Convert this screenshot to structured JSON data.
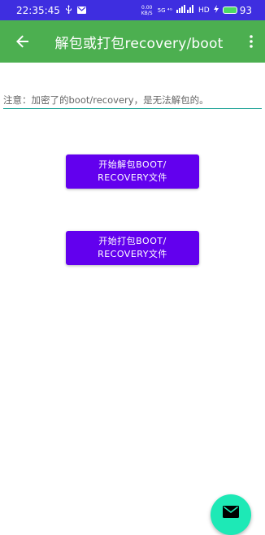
{
  "status_bar": {
    "time": "22:35:45",
    "network_speed": "0.00 KB/S",
    "signal": "5G ⁴ᴳ",
    "hd": "HD",
    "battery": "93"
  },
  "toolbar": {
    "title": "解包或打包recovery/boot"
  },
  "notice": "注意：加密了的boot/recovery，是无法解包的。",
  "buttons": {
    "unpack_line1": "开始解包BOOT/",
    "unpack_line2": "RECOVERY文件",
    "pack_line1": "开始打包BOOT/",
    "pack_line2": "RECOVERY文件"
  },
  "colors": {
    "status_bar": "#3e2ee0",
    "toolbar": "#4caf50",
    "button": "#6200ee",
    "fab": "#1de9b6",
    "underline": "#26a69a"
  },
  "icons": [
    "usb-icon",
    "mail-notification-icon",
    "back-arrow-icon",
    "more-vert-icon",
    "email-icon"
  ]
}
